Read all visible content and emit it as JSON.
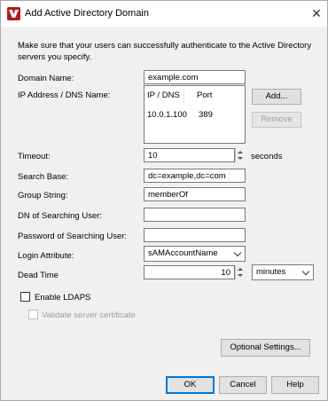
{
  "window": {
    "title": "Add Active Directory Domain",
    "close_glyph": "✕"
  },
  "intro_text": "Make sure that your users can successfully authenticate to the Active Directory servers you specify.",
  "domain_name": {
    "label": "Domain Name:",
    "value": "example.com"
  },
  "ip_dns": {
    "label": "IP Address / DNS Name:",
    "columns": [
      "IP / DNS",
      "Port"
    ],
    "rows": [
      {
        "ip": "10.0.1.100",
        "port": "389"
      }
    ],
    "add_label": "Add...",
    "remove_label": "Remove"
  },
  "timeout": {
    "label": "Timeout:",
    "value": "10",
    "unit": "seconds"
  },
  "search_base": {
    "label": "Search Base:",
    "value": "dc=example,dc=com"
  },
  "group_string": {
    "label": "Group String:",
    "value": "memberOf"
  },
  "dn_user": {
    "label": "DN of Searching User:",
    "value": ""
  },
  "password_user": {
    "label": "Password of Searching User:",
    "value": ""
  },
  "login_attribute": {
    "label": "Login Attribute:",
    "value": "sAMAccountName"
  },
  "dead_time": {
    "label": "Dead Time",
    "value": "10",
    "unit": "minutes"
  },
  "enable_ldaps": {
    "label": "Enable LDAPS",
    "checked": false
  },
  "validate_cert": {
    "label": "Validate server certificate",
    "checked": false,
    "enabled": false
  },
  "buttons": {
    "optional": "Optional Settings...",
    "ok": "OK",
    "cancel": "Cancel",
    "help": "Help"
  },
  "icons": {
    "app": "watchguard-logo-icon"
  }
}
